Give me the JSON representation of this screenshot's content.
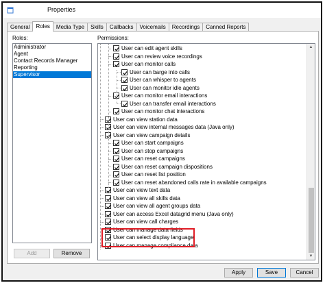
{
  "window": {
    "title": "Properties"
  },
  "tabs": [
    "General",
    "Roles",
    "Media Type",
    "Skills",
    "Callbacks",
    "Voicemails",
    "Recordings",
    "Canned Reports"
  ],
  "active_tab": "Roles",
  "roles": {
    "label": "Roles:",
    "items": [
      "Administrator",
      "Agent",
      "Contact Records Manager",
      "Reporting",
      "Supervisor"
    ],
    "selected": "Supervisor",
    "add_label": "Add",
    "remove_label": "Remove"
  },
  "permissions": {
    "label": "Permissions:",
    "items": [
      {
        "text": "User can edit agent skills",
        "level": 1
      },
      {
        "text": "User can review voice recordings",
        "level": 1
      },
      {
        "text": "User can monitor calls",
        "level": 1
      },
      {
        "text": "User can barge into calls",
        "level": 2
      },
      {
        "text": "User can whisper to agents",
        "level": 2
      },
      {
        "text": "User can monitor idle agents",
        "level": 2
      },
      {
        "text": "User can monitor email interactions",
        "level": 1
      },
      {
        "text": "User can transfer email interactions",
        "level": 2
      },
      {
        "text": "User can monitor chat interactions",
        "level": 1
      },
      {
        "text": "User can view station data",
        "level": 0
      },
      {
        "text": "User can view internal messages data (Java only)",
        "level": 0
      },
      {
        "text": "User can view campaign details",
        "level": 0
      },
      {
        "text": "User can start campaigns",
        "level": 1
      },
      {
        "text": "User can stop campaigns",
        "level": 1
      },
      {
        "text": "User can reset campaigns",
        "level": 1
      },
      {
        "text": "User can reset campaign dispositions",
        "level": 1
      },
      {
        "text": "User can reset list position",
        "level": 1
      },
      {
        "text": "User can reset abandoned calls rate in available campaigns",
        "level": 1
      },
      {
        "text": "User can view text data",
        "level": 0
      },
      {
        "text": "User can view all skills data",
        "level": 0
      },
      {
        "text": "User can view all agent groups data",
        "level": 0
      },
      {
        "text": "User can access Excel datagrid menu (Java only)",
        "level": 0
      },
      {
        "text": "User can view call charges",
        "level": 0
      },
      {
        "text": "User can manage data fields",
        "level": 0
      },
      {
        "text": "User can select display language",
        "level": 0
      },
      {
        "text": "User can manage compliance data",
        "level": 0
      }
    ]
  },
  "footer": {
    "apply_label": "Apply",
    "save_label": "Save",
    "cancel_label": "Cancel"
  },
  "colors": {
    "selection": "#0078d7",
    "highlight": "#e01b24"
  }
}
